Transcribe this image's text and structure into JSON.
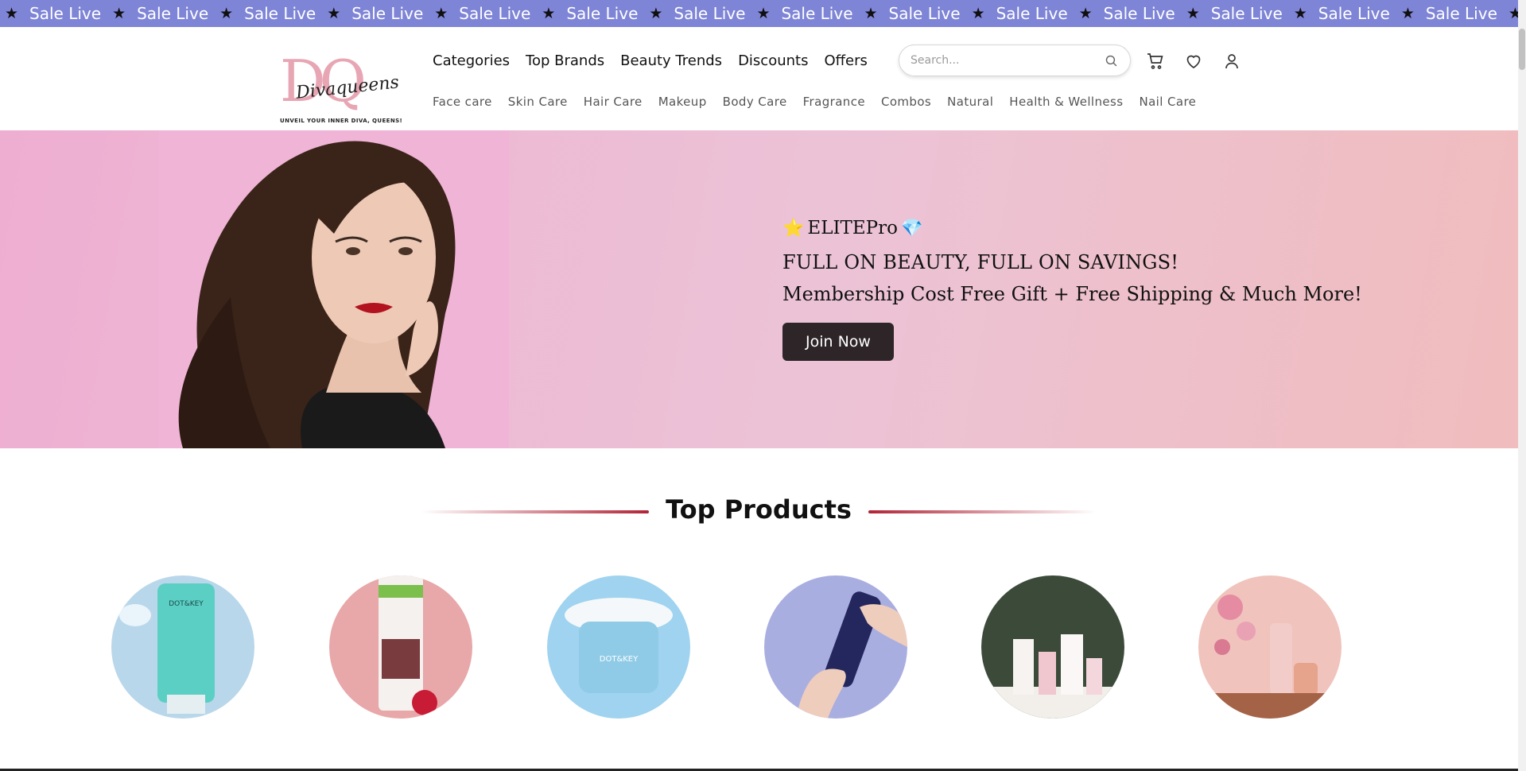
{
  "marquee": {
    "items": [
      "Sale Live",
      "Sale Live",
      "Sale Live",
      "Sale Live",
      "Sale Live",
      "Sale Live",
      "Sale Live",
      "Sale Live",
      "Sale Live",
      "Sale Live",
      "Sale Live",
      "Sale Live",
      "Sale Live",
      "Sale Live",
      "Sale Live"
    ],
    "separator": "★",
    "background": "#7f85d6"
  },
  "logo": {
    "letters": "DQ",
    "script": "Divaqueens",
    "tagline": "UNVEIL YOUR INNER DIVA, QUEENS!"
  },
  "primary_nav": [
    "Categories",
    "Top Brands",
    "Beauty Trends",
    "Discounts",
    "Offers"
  ],
  "search": {
    "placeholder": "Search..."
  },
  "header_icons": [
    "cart-icon",
    "heart-icon",
    "user-icon"
  ],
  "secondary_nav": [
    "Face care",
    "Skin Care",
    "Hair Care",
    "Makeup",
    "Body Care",
    "Fragrance",
    "Combos",
    "Natural",
    "Health & Wellness",
    "Nail Care"
  ],
  "hero": {
    "badge_left_emoji": "⭐",
    "badge": "ELITEPro",
    "badge_right_emoji": "💎",
    "headline": "FULL ON BEAUTY, FULL ON SAVINGS!",
    "subline": "Membership Cost Free Gift + Free Shipping & Much More!",
    "cta": "Join Now",
    "accent": "#2e2528"
  },
  "top_products": {
    "title": "Top Products",
    "accent": "#b12436",
    "items": [
      {
        "image": "teal-body-lotion-tube"
      },
      {
        "image": "mamaearth-face-wash-tube"
      },
      {
        "image": "blue-hydrating-gel-jar"
      },
      {
        "image": "serum-pump-bottle-in-hand"
      },
      {
        "image": "skincare-set-on-table"
      },
      {
        "image": "pink-bottles-with-blossoms"
      }
    ]
  }
}
